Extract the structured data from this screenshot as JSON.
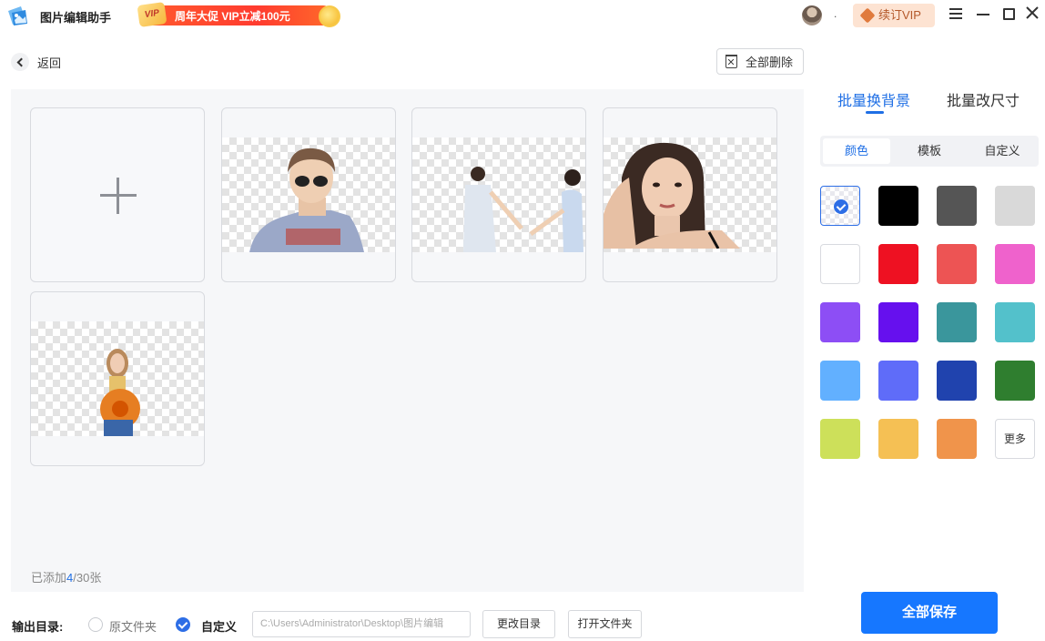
{
  "app": {
    "title": "图片编辑助手",
    "promo_badge": "VIP",
    "promo_text": "周年大促 VIP立减100元",
    "separator": ".",
    "renew_label": "续订VIP"
  },
  "toolbar": {
    "back_label": "返回",
    "delete_all_label": "全部删除"
  },
  "workspace": {
    "images": [
      {
        "name": "man-with-sunglasses"
      },
      {
        "name": "two-girls-holding-hands"
      },
      {
        "name": "woman-portrait"
      },
      {
        "name": "woman-with-orange-hat"
      }
    ],
    "count_prefix": "已添加",
    "count_added": "4",
    "count_suffix": "/30张"
  },
  "sidebar": {
    "tabs": [
      {
        "label": "批量换背景",
        "active": true
      },
      {
        "label": "批量改尺寸",
        "active": false
      }
    ],
    "segments": [
      {
        "label": "颜色",
        "active": true
      },
      {
        "label": "模板",
        "active": false
      },
      {
        "label": "自定义",
        "active": false
      }
    ],
    "swatches": [
      {
        "color": "transparent",
        "selected": true
      },
      {
        "color": "#000000"
      },
      {
        "color": "#555555"
      },
      {
        "color": "#d9d9d9"
      },
      {
        "color": "#ffffff"
      },
      {
        "color": "#ee1122"
      },
      {
        "color": "#ed5454"
      },
      {
        "color": "#ef62cc"
      },
      {
        "color": "#8d4ef5"
      },
      {
        "color": "#6610ee"
      },
      {
        "color": "#3a969c"
      },
      {
        "color": "#53c1cb"
      },
      {
        "color": "#62b0ff"
      },
      {
        "color": "#5f6cf9"
      },
      {
        "color": "#2043ae"
      },
      {
        "color": "#2f7e2f"
      },
      {
        "color": "#cde05a"
      },
      {
        "color": "#f5c054"
      },
      {
        "color": "#f0944b"
      }
    ],
    "more_label": "更多"
  },
  "output": {
    "label": "输出目录:",
    "option_original": "原文件夹",
    "option_custom": "自定义",
    "path_placeholder": "C:\\Users\\Administrator\\Desktop\\图片编辑",
    "change_dir_label": "更改目录",
    "open_folder_label": "打开文件夹",
    "save_all_label": "全部保存"
  },
  "colors": {
    "accent": "#1677ff",
    "workspace_bg": "#f6f7f9"
  }
}
